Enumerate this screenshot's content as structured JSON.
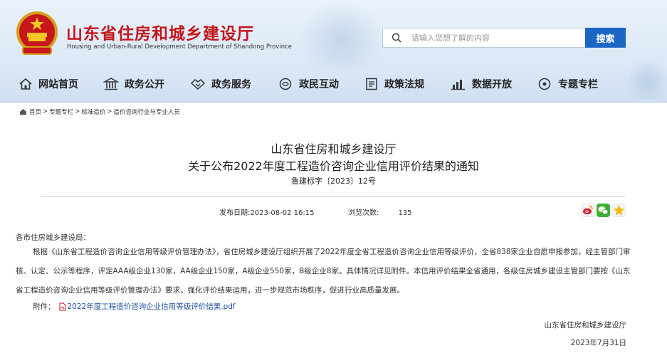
{
  "header": {
    "title": "山东省住房和城乡建设厅",
    "subtitle": "Housing and Urban-Rural Development Department of Shandong Province",
    "search_placeholder": "请输入您想了解的内容",
    "search_button": "搜索"
  },
  "nav": [
    {
      "label": "网站首页",
      "icon": "home-icon"
    },
    {
      "label": "政务公开",
      "icon": "building-icon"
    },
    {
      "label": "政务服务",
      "icon": "handshake-icon"
    },
    {
      "label": "政民互动",
      "icon": "interaction-icon"
    },
    {
      "label": "政策法规",
      "icon": "document-icon"
    },
    {
      "label": "数据开放",
      "icon": "bar-chart-icon"
    },
    {
      "label": "专题专栏",
      "icon": "topic-icon"
    }
  ],
  "breadcrumb": [
    "首页",
    "专题专栏",
    "标准造价",
    "造价咨询行业与专业人员"
  ],
  "breadcrumb_separator": ">",
  "article": {
    "title_line1": "山东省住房和城乡建设厅",
    "title_line2": "关于公布2022年度工程造价咨询企业信用评价结果的通知",
    "doc_number": "鲁建标字〔2023〕12号",
    "publish_label": "发布日期:",
    "publish_date": "2023-08-02 16:15",
    "views_label": "浏览次数:",
    "views": "135",
    "salutation": "各市住房城乡建设局：",
    "paragraph": "根据《山东省工程造价咨询企业信用等级评价管理办法》，省住房城乡建设厅组织开展了2022年度全省工程造价咨询企业信用等级评价，全省838家企业自愿申报参加，经主管部门审核、认定、公示等程序，评定AAA级企业130家，AA级企业150家，A级企业550家，B级企业8家。具体情况详见附件。本信用评价结果全省通用，各级住房城乡建设主管部门要按《山东省工程造价咨询企业信用等级评价管理办法》要求，强化评价结果运用，进一步规范市场秩序，促进行业高质量发展。",
    "attachment_label": "附件：",
    "attachment_link": "2022年度工程造价咨询企业信用等级评价结果.pdf",
    "signature_org": "山东省住房和城乡建设厅",
    "signature_date": "2023年7月31日"
  },
  "share_icons": [
    "weibo-icon",
    "wechat-icon",
    "qzone-icon"
  ],
  "colors": {
    "title_red": "#c2171d",
    "search_blue": "#1b66c4",
    "link_blue": "#2050a0"
  }
}
